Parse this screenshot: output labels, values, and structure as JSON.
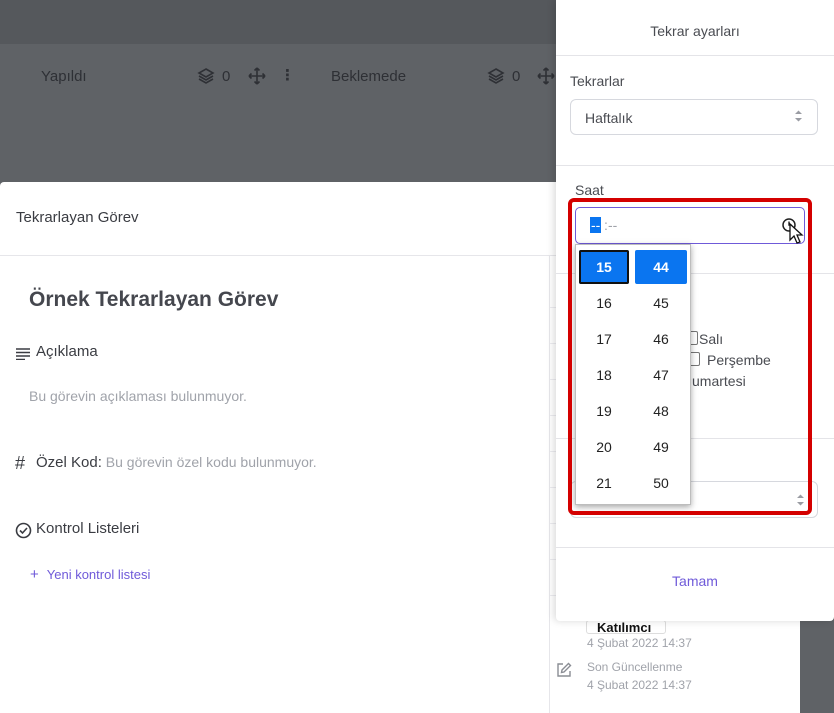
{
  "board": {
    "columns": [
      {
        "title": "Yapıldı",
        "count": "0"
      },
      {
        "title": "Beklemede",
        "count": "0"
      }
    ]
  },
  "task_modal": {
    "header": "Tekrarlayan Görev",
    "title": "Örnek Tekrarlayan Görev",
    "description_label": "Açıklama",
    "description_empty": "Bu görevin açıklaması bulunmuyor.",
    "custom_code_label": "Özel Kod:",
    "custom_code_empty": "Bu görevin özel kodu bulunmuyor.",
    "checklists_label": "Kontrol Listeleri",
    "new_checklist_link": "Yeni kontrol listesi",
    "sidebar": {
      "participant_label": "Katılımcı",
      "participant_date": "4 Şubat 2022 14:37",
      "last_update_label": "Son Güncellenme",
      "last_update_date": "4 Şubat 2022 14:37"
    }
  },
  "repeat_panel": {
    "title": "Tekrar ayarları",
    "repeats_label": "Tekrarlar",
    "repeats_value": "Haftalık",
    "time_label": "Saat",
    "time_hour_placeholder": "--",
    "time_sep": ":",
    "time_minute_placeholder": "--",
    "days_partial": [
      "Salı",
      "Perşembe",
      "umartesi"
    ],
    "done_button": "Tamam"
  },
  "time_dropdown": {
    "hours": [
      "15",
      "16",
      "17",
      "18",
      "19",
      "20",
      "21"
    ],
    "minutes": [
      "44",
      "45",
      "46",
      "47",
      "48",
      "49",
      "50"
    ],
    "selected_hour": "15",
    "selected_minute": "44"
  },
  "colors": {
    "accent": "#6f5ad9",
    "selected": "#0a75f0",
    "highlight": "#d40000"
  }
}
